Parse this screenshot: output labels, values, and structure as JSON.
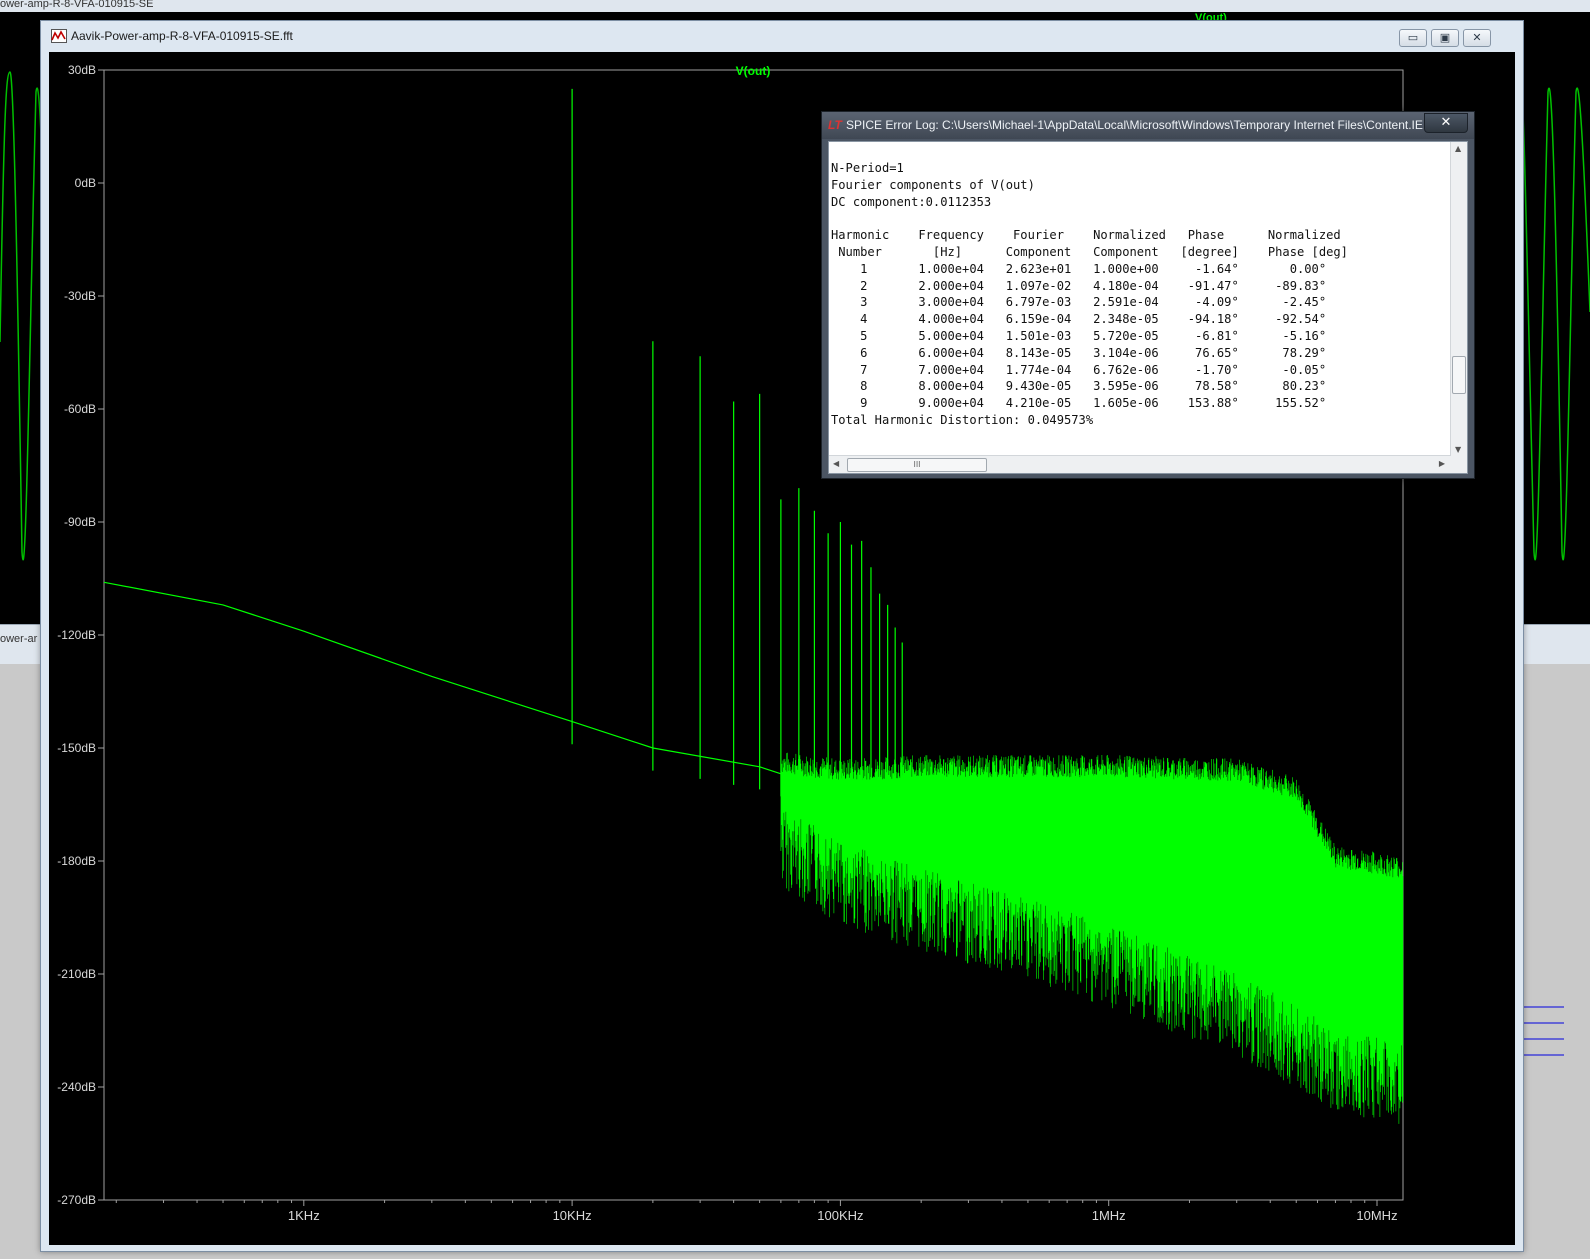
{
  "background": {
    "window_title": "ower-amp-R-8-VFA-010915-SE",
    "trace_label": "V(out)",
    "tab_label": "ower-ar"
  },
  "fft_window": {
    "title": "Aavik-Power-amp-R-8-VFA-010915-SE.fft",
    "icon": "waveform-icon",
    "buttons": {
      "minimize": "▭",
      "maximize": "▣",
      "close": "✕"
    }
  },
  "chart_data": {
    "type": "line",
    "title": "V(out)",
    "x_scale": "log",
    "xlim": [
      180,
      12500000
    ],
    "ylim": [
      -270,
      30
    ],
    "x_ticks": [
      {
        "value": 1000,
        "label": "1KHz"
      },
      {
        "value": 10000,
        "label": "10KHz"
      },
      {
        "value": 100000,
        "label": "100KHz"
      },
      {
        "value": 1000000,
        "label": "1MHz"
      },
      {
        "value": 10000000,
        "label": "10MHz"
      }
    ],
    "y_ticks": [
      {
        "value": 30,
        "label": "30dB"
      },
      {
        "value": 0,
        "label": "0dB"
      },
      {
        "value": -30,
        "label": "-30dB"
      },
      {
        "value": -60,
        "label": "-60dB"
      },
      {
        "value": -90,
        "label": "-90dB"
      },
      {
        "value": -120,
        "label": "-120dB"
      },
      {
        "value": -150,
        "label": "-150dB"
      },
      {
        "value": -180,
        "label": "-180dB"
      },
      {
        "value": -210,
        "label": "-210dB"
      },
      {
        "value": -240,
        "label": "-240dB"
      },
      {
        "value": -270,
        "label": "-270dB"
      }
    ],
    "trace_color": "#00ff00",
    "noise_floor": [
      {
        "x": 180,
        "y": -106
      },
      {
        "x": 500,
        "y": -112
      },
      {
        "x": 1000,
        "y": -119
      },
      {
        "x": 3000,
        "y": -131
      },
      {
        "x": 10000,
        "y": -143
      },
      {
        "x": 20000,
        "y": -150
      },
      {
        "x": 50000,
        "y": -155
      },
      {
        "x": 100000,
        "y": -162
      }
    ],
    "noise_band": [
      {
        "x": 60000,
        "top": -155,
        "bottom": -165
      },
      {
        "x": 100000,
        "top": -157,
        "bottom": -175
      },
      {
        "x": 200000,
        "top": -156,
        "bottom": -182
      },
      {
        "x": 500000,
        "top": -156,
        "bottom": -190
      },
      {
        "x": 1000000,
        "top": -156,
        "bottom": -197
      },
      {
        "x": 3000000,
        "top": -157,
        "bottom": -210
      },
      {
        "x": 5000000,
        "top": -162,
        "bottom": -218
      },
      {
        "x": 7000000,
        "top": -180,
        "bottom": -225
      },
      {
        "x": 12500000,
        "top": -183,
        "bottom": -228
      }
    ],
    "harmonic_peaks": [
      {
        "x": 10000,
        "y": 25
      },
      {
        "x": 20000,
        "y": -42
      },
      {
        "x": 30000,
        "y": -46
      },
      {
        "x": 40000,
        "y": -58
      },
      {
        "x": 50000,
        "y": -56
      },
      {
        "x": 60000,
        "y": -84
      },
      {
        "x": 70000,
        "y": -81
      },
      {
        "x": 80000,
        "y": -87
      },
      {
        "x": 90000,
        "y": -93
      },
      {
        "x": 100000,
        "y": -90
      },
      {
        "x": 110000,
        "y": -96
      },
      {
        "x": 120000,
        "y": -95
      },
      {
        "x": 130000,
        "y": -102
      },
      {
        "x": 140000,
        "y": -109
      },
      {
        "x": 150000,
        "y": -112
      },
      {
        "x": 160000,
        "y": -118
      },
      {
        "x": 170000,
        "y": -122
      }
    ]
  },
  "error_log": {
    "icon": "LT",
    "title": "SPICE Error Log: C:\\Users\\Michael-1\\AppData\\Local\\Microsoft\\Windows\\Temporary Internet Files\\Content.IE...",
    "close_label": "✕",
    "text": "N-Period=1\nFourier components of V(out)\nDC component:0.0112353\n\nHarmonic    Frequency    Fourier    Normalized   Phase      Normalized\n Number       [Hz]      Component   Component   [degree]    Phase [deg]\n    1       1.000e+04   2.623e+01   1.000e+00     -1.64°       0.00°\n    2       2.000e+04   1.097e-02   4.180e-04    -91.47°     -89.83°\n    3       3.000e+04   6.797e-03   2.591e-04     -4.09°      -2.45°\n    4       4.000e+04   6.159e-04   2.348e-05    -94.18°     -92.54°\n    5       5.000e+04   1.501e-03   5.720e-05     -6.81°      -5.16°\n    6       6.000e+04   8.143e-05   3.104e-06     76.65°      78.29°\n    7       7.000e+04   1.774e-04   6.762e-06     -1.70°      -0.05°\n    8       8.000e+04   9.430e-05   3.595e-06     78.58°      80.23°\n    9       9.000e+04   4.210e-05   1.605e-06    153.88°     155.52°\nTotal Harmonic Distortion: 0.049573%",
    "hscroll_grip": "III"
  }
}
